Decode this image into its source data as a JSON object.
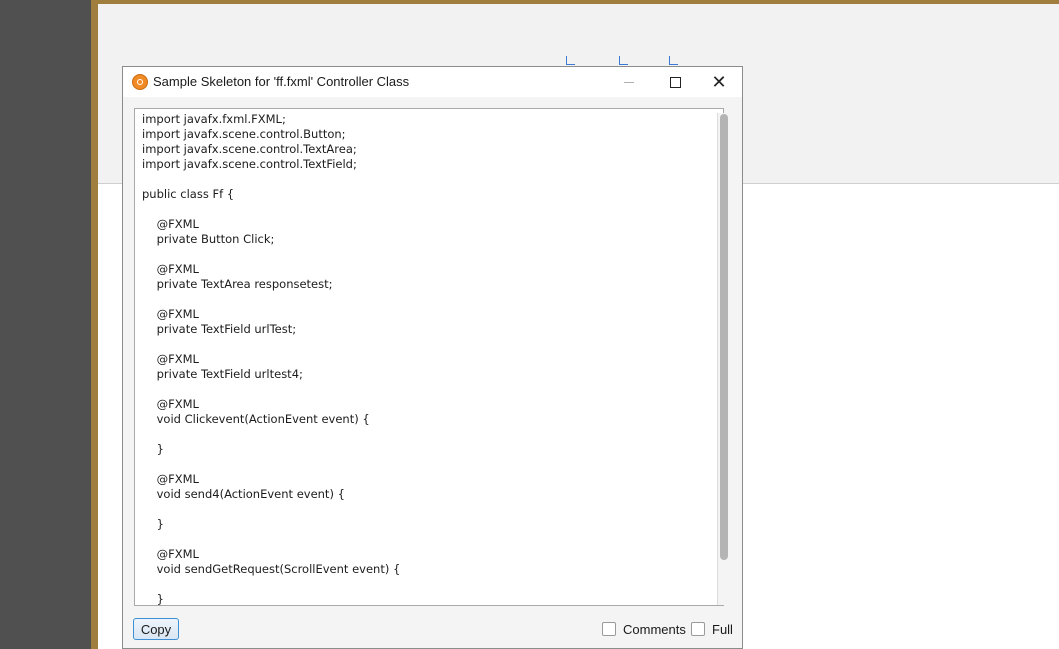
{
  "dialog": {
    "title": "Sample Skeleton for 'ff.fxml' Controller Class",
    "window_controls": {
      "minimize_icon": "minimize-icon",
      "maximize_icon": "maximize-icon",
      "close_glyph": "✕"
    },
    "code_lines": [
      "import javafx.fxml.FXML;",
      "import javafx.scene.control.Button;",
      "import javafx.scene.control.TextArea;",
      "import javafx.scene.control.TextField;",
      "",
      "public class Ff {",
      "",
      "    @FXML",
      "    private Button Click;",
      "",
      "    @FXML",
      "    private TextArea responsetest;",
      "",
      "    @FXML",
      "    private TextField urlTest;",
      "",
      "    @FXML",
      "    private TextField urltest4;",
      "",
      "    @FXML",
      "    void Clickevent(ActionEvent event) {",
      "",
      "    }",
      "",
      "    @FXML",
      "    void send4(ActionEvent event) {",
      "",
      "    }",
      "",
      "    @FXML",
      "    void sendGetRequest(ScrollEvent event) {",
      "",
      "    }"
    ],
    "copy_label": "Copy",
    "comments_label": "Comments",
    "comments_checked": false,
    "full_label": "Full",
    "full_checked": false
  },
  "colors": {
    "accent": "#3d8fd6",
    "frame_gold": "#a07e3e"
  }
}
